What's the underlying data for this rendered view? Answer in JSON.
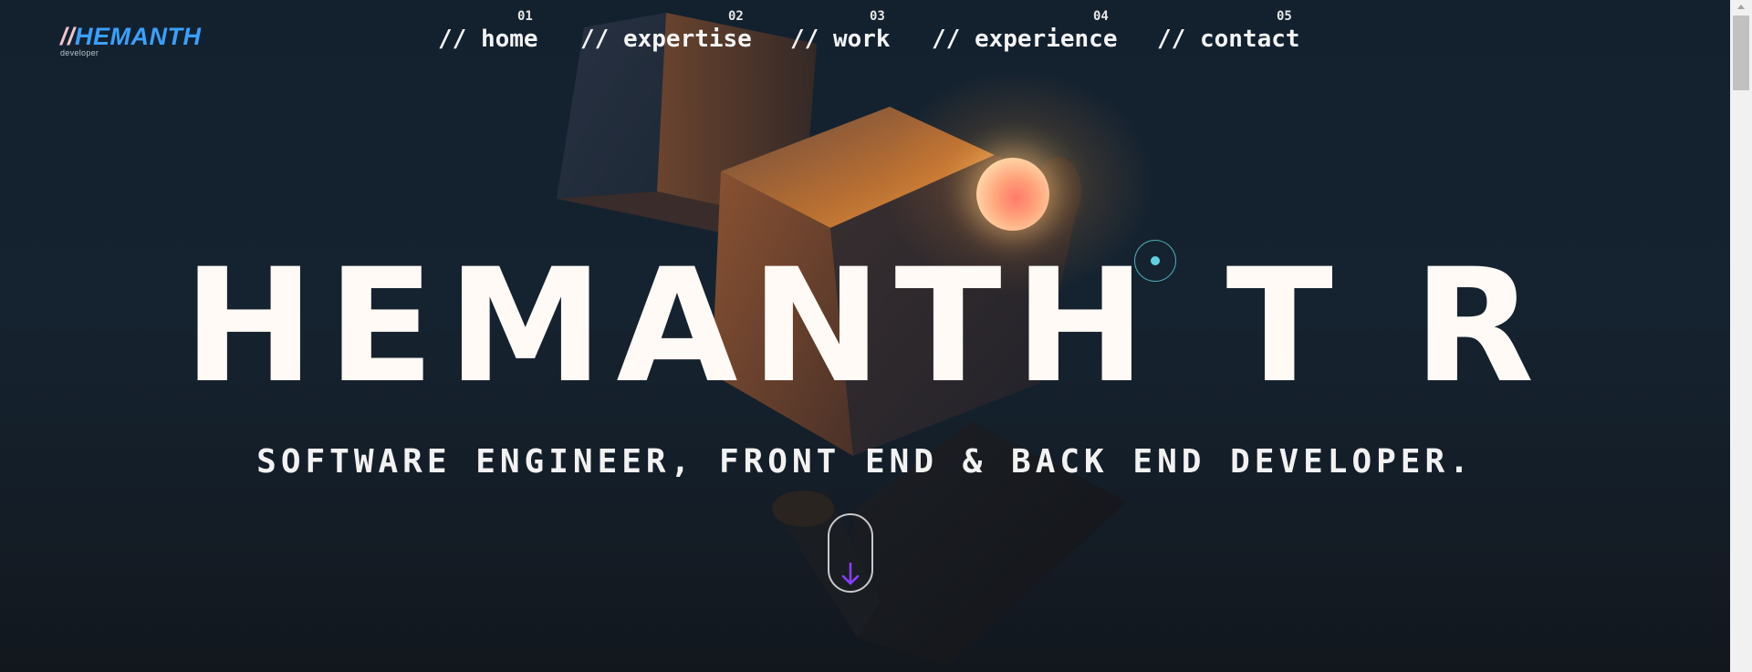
{
  "logo": {
    "slashes": "//",
    "name": "HEMANTH",
    "subtitle": "developer"
  },
  "nav": [
    {
      "num": "01",
      "label": "// home"
    },
    {
      "num": "02",
      "label": "// expertise"
    },
    {
      "num": "03",
      "label": "// work"
    },
    {
      "num": "04",
      "label": "// experience"
    },
    {
      "num": "05",
      "label": "// contact"
    }
  ],
  "hero": {
    "title": "HEMANTH T R",
    "subtitle": "SOFTWARE ENGINEER, FRONT END & BACK END DEVELOPER."
  },
  "icons": {
    "scroll": "arrow-down-icon"
  },
  "colors": {
    "background": "#13212f",
    "logo_name": "#3aa0ff",
    "logo_slashes": "#f0c2cf",
    "scroll_arrow": "#8a3cff",
    "cursor": "#5fd1e0"
  }
}
